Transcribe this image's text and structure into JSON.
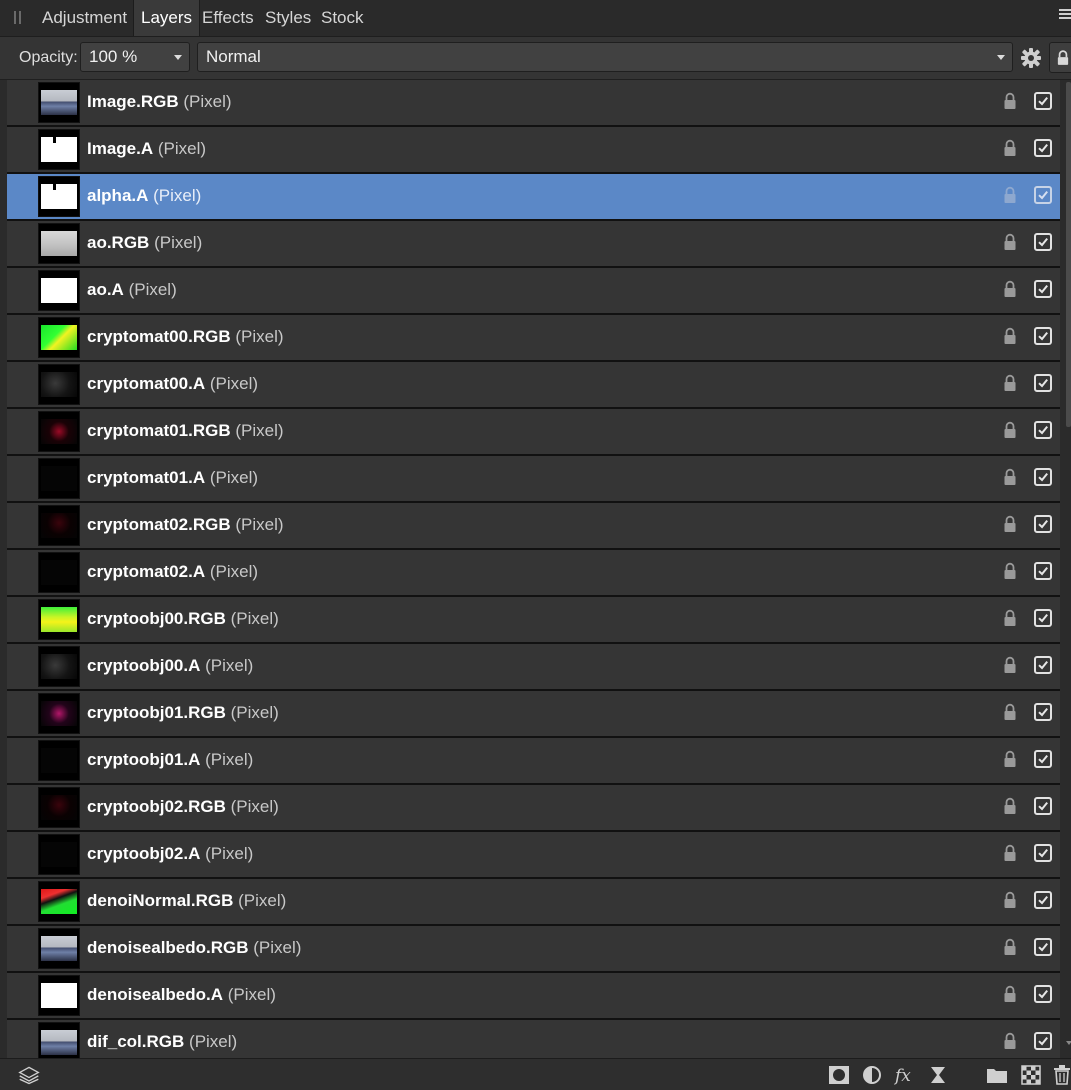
{
  "tabs": [
    {
      "label": "Adjustment"
    },
    {
      "label": "Layers",
      "active": true
    },
    {
      "label": "Effects"
    },
    {
      "label": "Styles"
    },
    {
      "label": "Stock"
    }
  ],
  "panel_menu_icon": "hamburger-menu-icon",
  "options": {
    "opacity_label": "Opacity:",
    "opacity_value": "100 %",
    "blend_mode": "Normal",
    "settings_icon": "gear-icon",
    "lock_icon": "lock-icon"
  },
  "layers": [
    {
      "name": "Image.RGB",
      "type": "(Pixel)",
      "thumb": "render",
      "selected": false,
      "visible": true
    },
    {
      "name": "Image.A",
      "type": "(Pixel)",
      "thumb": "white-mark",
      "selected": false,
      "visible": true
    },
    {
      "name": "alpha.A",
      "type": "(Pixel)",
      "thumb": "white-mark",
      "selected": true,
      "visible": true
    },
    {
      "name": "ao.RGB",
      "type": "(Pixel)",
      "thumb": "grey",
      "selected": false,
      "visible": true
    },
    {
      "name": "ao.A",
      "type": "(Pixel)",
      "thumb": "white",
      "selected": false,
      "visible": true
    },
    {
      "name": "cryptomat00.RGB",
      "type": "(Pixel)",
      "thumb": "green",
      "selected": false,
      "visible": true
    },
    {
      "name": "cryptomat00.A",
      "type": "(Pixel)",
      "thumb": "dark-noise",
      "selected": false,
      "visible": true
    },
    {
      "name": "cryptomat01.RGB",
      "type": "(Pixel)",
      "thumb": "red-dots",
      "selected": false,
      "visible": true
    },
    {
      "name": "cryptomat01.A",
      "type": "(Pixel)",
      "thumb": "black",
      "selected": false,
      "visible": true
    },
    {
      "name": "cryptomat02.RGB",
      "type": "(Pixel)",
      "thumb": "dark-red",
      "selected": false,
      "visible": true
    },
    {
      "name": "cryptomat02.A",
      "type": "(Pixel)",
      "thumb": "black",
      "selected": false,
      "visible": true
    },
    {
      "name": "cryptoobj00.RGB",
      "type": "(Pixel)",
      "thumb": "green-yellow",
      "selected": false,
      "visible": true
    },
    {
      "name": "cryptoobj00.A",
      "type": "(Pixel)",
      "thumb": "dark-noise",
      "selected": false,
      "visible": true
    },
    {
      "name": "cryptoobj01.RGB",
      "type": "(Pixel)",
      "thumb": "pink-dots",
      "selected": false,
      "visible": true
    },
    {
      "name": "cryptoobj01.A",
      "type": "(Pixel)",
      "thumb": "black",
      "selected": false,
      "visible": true
    },
    {
      "name": "cryptoobj02.RGB",
      "type": "(Pixel)",
      "thumb": "dark-red",
      "selected": false,
      "visible": true
    },
    {
      "name": "cryptoobj02.A",
      "type": "(Pixel)",
      "thumb": "black",
      "selected": false,
      "visible": true
    },
    {
      "name": "denoiNormal.RGB",
      "type": "(Pixel)",
      "thumb": "normal",
      "selected": false,
      "visible": true
    },
    {
      "name": "denoisealbedo.RGB",
      "type": "(Pixel)",
      "thumb": "render",
      "selected": false,
      "visible": true
    },
    {
      "name": "denoisealbedo.A",
      "type": "(Pixel)",
      "thumb": "white",
      "selected": false,
      "visible": true
    },
    {
      "name": "dif_col.RGB",
      "type": "(Pixel)",
      "thumb": "render",
      "selected": false,
      "visible": true
    }
  ],
  "bottom_toolbar": [
    "layers-stack-icon",
    "mask-layer-icon",
    "adjustment-icon",
    "fx-icon",
    "live-filter-icon",
    "folder-icon",
    "pixel-layer-icon",
    "trash-icon"
  ],
  "colors": {
    "selected_row": "#5b88c7",
    "row_bg": "#353535",
    "panel_bg": "#2b2b2b"
  }
}
